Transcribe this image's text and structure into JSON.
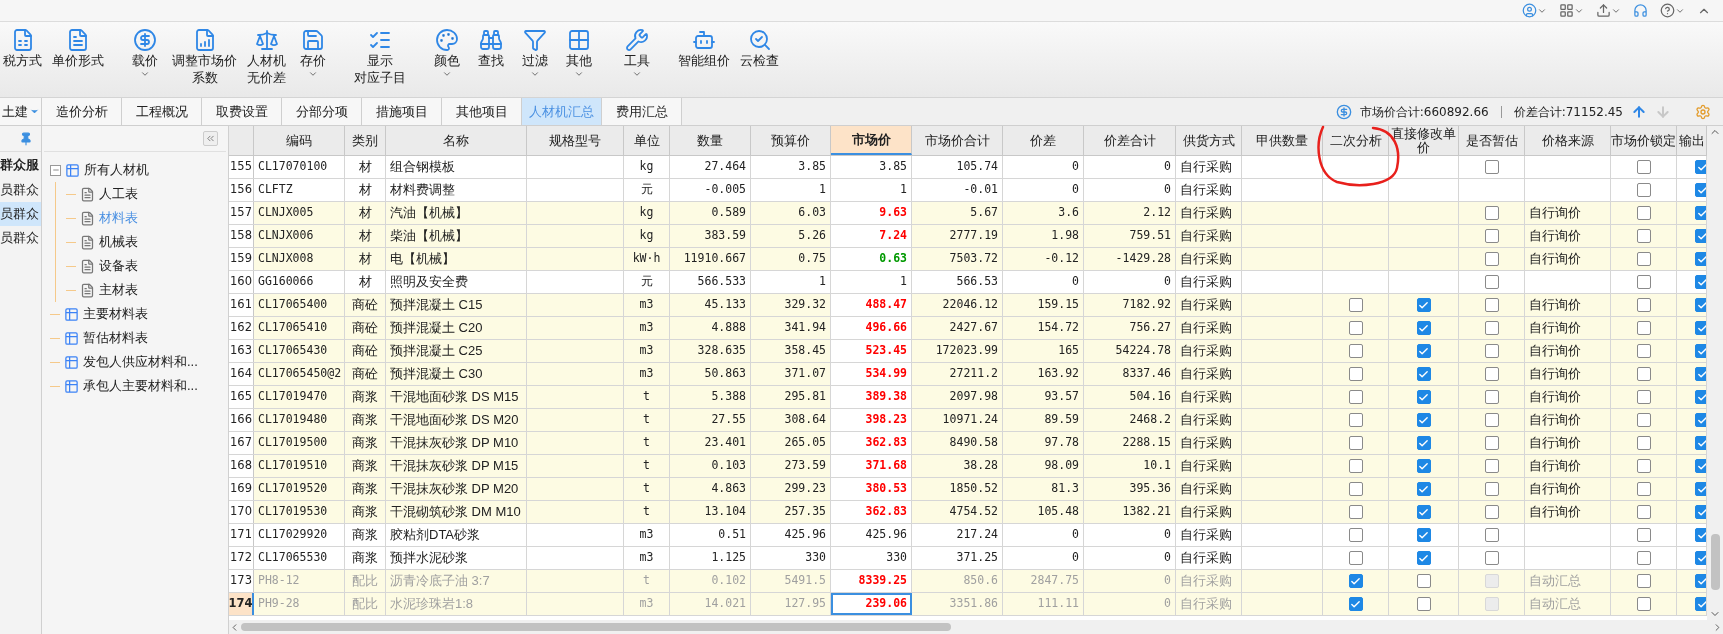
{
  "toolbar": {
    "groups": [
      {
        "items": [
          {
            "lines": [
              "税方式"
            ],
            "dropdown": false
          },
          {
            "lines": [
              "单价形式"
            ],
            "dropdown": false
          }
        ]
      },
      {
        "items": [
          {
            "lines": [
              "载价"
            ],
            "dropdown": true
          },
          {
            "lines": [
              "调整市场价",
              "系数"
            ],
            "dropdown": false
          },
          {
            "lines": [
              "人材机",
              "无价差"
            ],
            "dropdown": false
          },
          {
            "lines": [
              "存价"
            ],
            "dropdown": true
          }
        ]
      },
      {
        "items": [
          {
            "lines": [
              "显示",
              "对应子目"
            ],
            "dropdown": false
          }
        ]
      },
      {
        "items": [
          {
            "lines": [
              "颜色"
            ],
            "dropdown": true
          },
          {
            "lines": [
              "查找"
            ],
            "dropdown": false
          },
          {
            "lines": [
              "过滤"
            ],
            "dropdown": true
          },
          {
            "lines": [
              "其他"
            ],
            "dropdown": true
          }
        ]
      },
      {
        "items": [
          {
            "lines": [
              "工具"
            ],
            "dropdown": true
          }
        ]
      },
      {
        "items": [
          {
            "lines": [
              "智能组价"
            ],
            "dropdown": false
          },
          {
            "lines": [
              "云检查"
            ],
            "dropdown": false
          }
        ]
      }
    ]
  },
  "tabs": [
    {
      "label": "土建",
      "selected": false,
      "dropdown": true
    },
    {
      "label": "造价分析",
      "selected": false,
      "dropdown": false
    },
    {
      "label": "工程概况",
      "selected": false,
      "dropdown": false
    },
    {
      "label": "取费设置",
      "selected": false,
      "dropdown": false
    },
    {
      "label": "分部分项",
      "selected": false,
      "dropdown": false
    },
    {
      "label": "措施项目",
      "selected": false,
      "dropdown": false
    },
    {
      "label": "其他项目",
      "selected": false,
      "dropdown": false
    },
    {
      "label": "人材机汇总",
      "selected": true,
      "dropdown": false
    },
    {
      "label": "费用汇总",
      "selected": false,
      "dropdown": false
    }
  ],
  "summary": [
    "市场价合计:660892.66",
    "价差合计:71152.45"
  ],
  "side_list": {
    "heading": "群众服",
    "items": [
      {
        "label": "员群众",
        "selected": false
      },
      {
        "label": "员群众",
        "selected": true
      },
      {
        "label": "员群众",
        "selected": false
      }
    ]
  },
  "tree": [
    {
      "label": "所有人材机",
      "kind": "group",
      "expanded": true,
      "selected": false,
      "children": [
        {
          "label": "人工表",
          "kind": "sheet",
          "selected": false
        },
        {
          "label": "材料表",
          "kind": "sheet",
          "selected": true
        },
        {
          "label": "机械表",
          "kind": "sheet",
          "selected": false
        },
        {
          "label": "设备表",
          "kind": "sheet",
          "selected": false
        },
        {
          "label": "主材表",
          "kind": "sheet",
          "selected": false
        }
      ]
    },
    {
      "label": "主要材料表",
      "kind": "group",
      "selected": false
    },
    {
      "label": "暂估材料表",
      "kind": "group",
      "selected": false
    },
    {
      "label": "发包人供应材料和...",
      "kind": "group",
      "selected": false
    },
    {
      "label": "承包人主要材料和...",
      "kind": "group",
      "selected": false
    }
  ],
  "table": {
    "columns": [
      {
        "label": "编码",
        "selected": false
      },
      {
        "label": "类别",
        "selected": false
      },
      {
        "label": "名称",
        "selected": false
      },
      {
        "label": "规格型号",
        "selected": false
      },
      {
        "label": "单位",
        "selected": false
      },
      {
        "label": "数量",
        "selected": false
      },
      {
        "label": "预算价",
        "selected": false
      },
      {
        "label": "市场价",
        "selected": true
      },
      {
        "label": "市场价合计",
        "selected": false
      },
      {
        "label": "价差",
        "selected": false
      },
      {
        "label": "价差合计",
        "selected": false
      },
      {
        "label": "供货方式",
        "selected": false
      },
      {
        "label": "甲供数量",
        "selected": false
      },
      {
        "label": "二次分析",
        "selected": false
      },
      {
        "label": "直接修改单价",
        "selected": false
      },
      {
        "label": "是否暂估",
        "selected": false
      },
      {
        "label": "价格来源",
        "selected": false
      },
      {
        "label": "市场价锁定",
        "selected": false
      },
      {
        "label": "输出",
        "selected": false
      }
    ],
    "rows": [
      {
        "no": "155",
        "code": "CL17070100",
        "category": "材",
        "name": "组合钢模板",
        "unit": "kg",
        "quantity": "27.464",
        "budget_price": "3.85",
        "market_price": "3.85",
        "above_budget": false,
        "below_budget": false,
        "market_total": "105.74",
        "price_diff": "0",
        "diff_total": "0",
        "supply": "自行采购",
        "provisional": false,
        "provisional_disabled": false,
        "price_lock": false,
        "output": true,
        "shaded": false,
        "greyed": false,
        "selected": false
      },
      {
        "no": "156",
        "code": "CLFTZ",
        "category": "材",
        "name": "材料费调整",
        "unit": "元",
        "quantity": "-0.005",
        "budget_price": "1",
        "market_price": "1",
        "above_budget": false,
        "below_budget": false,
        "market_total": "-0.01",
        "price_diff": "0",
        "diff_total": "0",
        "supply": "自行采购",
        "price_lock": false,
        "output": true,
        "shaded": false,
        "greyed": false,
        "selected": false
      },
      {
        "no": "157",
        "code": "CLNJX005",
        "category": "材",
        "name": "汽油【机械】",
        "unit": "kg",
        "quantity": "0.589",
        "budget_price": "6.03",
        "market_price": "9.63",
        "above_budget": true,
        "below_budget": false,
        "market_total": "5.67",
        "price_diff": "3.6",
        "diff_total": "2.12",
        "supply": "自行采购",
        "provisional": false,
        "provisional_disabled": false,
        "price_source": "自行询价",
        "price_lock": false,
        "output": true,
        "shaded": true,
        "greyed": false,
        "selected": false
      },
      {
        "no": "158",
        "code": "CLNJX006",
        "category": "材",
        "name": "柴油【机械】",
        "unit": "kg",
        "quantity": "383.59",
        "budget_price": "5.26",
        "market_price": "7.24",
        "above_budget": true,
        "below_budget": false,
        "market_total": "2777.19",
        "price_diff": "1.98",
        "diff_total": "759.51",
        "supply": "自行采购",
        "provisional": false,
        "provisional_disabled": false,
        "price_source": "自行询价",
        "price_lock": false,
        "output": true,
        "shaded": true,
        "greyed": false,
        "selected": false
      },
      {
        "no": "159",
        "code": "CLNJX008",
        "category": "材",
        "name": "电【机械】",
        "unit": "kW·h",
        "quantity": "11910.667",
        "budget_price": "0.75",
        "market_price": "0.63",
        "above_budget": false,
        "below_budget": true,
        "market_total": "7503.72",
        "price_diff": "-0.12",
        "diff_total": "-1429.28",
        "supply": "自行采购",
        "provisional": false,
        "provisional_disabled": false,
        "price_source": "自行询价",
        "price_lock": false,
        "output": true,
        "shaded": true,
        "greyed": false,
        "selected": false
      },
      {
        "no": "160",
        "code": "GG160066",
        "category": "材",
        "name": "照明及安全费",
        "unit": "元",
        "quantity": "566.533",
        "budget_price": "1",
        "market_price": "1",
        "above_budget": false,
        "below_budget": false,
        "market_total": "566.53",
        "price_diff": "0",
        "diff_total": "0",
        "supply": "自行采购",
        "provisional": false,
        "provisional_disabled": false,
        "price_lock": false,
        "output": true,
        "shaded": false,
        "greyed": false,
        "selected": false
      },
      {
        "no": "161",
        "code": "CL17065400",
        "category": "商砼",
        "name": "预拌混凝土 C15",
        "unit": "m3",
        "quantity": "45.133",
        "budget_price": "329.32",
        "market_price": "488.47",
        "above_budget": true,
        "below_budget": false,
        "market_total": "22046.12",
        "price_diff": "159.15",
        "diff_total": "7182.92",
        "supply": "自行采购",
        "second_analysis": false,
        "direct_edit": true,
        "provisional": false,
        "provisional_disabled": false,
        "price_source": "自行询价",
        "price_lock": false,
        "output": true,
        "shaded": true,
        "greyed": false,
        "selected": false
      },
      {
        "no": "162",
        "code": "CL17065410",
        "category": "商砼",
        "name": "预拌混凝土 C20",
        "unit": "m3",
        "quantity": "4.888",
        "budget_price": "341.94",
        "market_price": "496.66",
        "above_budget": true,
        "below_budget": false,
        "market_total": "2427.67",
        "price_diff": "154.72",
        "diff_total": "756.27",
        "supply": "自行采购",
        "second_analysis": false,
        "direct_edit": true,
        "provisional": false,
        "provisional_disabled": false,
        "price_source": "自行询价",
        "price_lock": false,
        "output": true,
        "shaded": true,
        "greyed": false,
        "selected": false
      },
      {
        "no": "163",
        "code": "CL17065430",
        "category": "商砼",
        "name": "预拌混凝土 C25",
        "unit": "m3",
        "quantity": "328.635",
        "budget_price": "358.45",
        "market_price": "523.45",
        "above_budget": true,
        "below_budget": false,
        "market_total": "172023.99",
        "price_diff": "165",
        "diff_total": "54224.78",
        "supply": "自行采购",
        "second_analysis": false,
        "direct_edit": true,
        "provisional": false,
        "provisional_disabled": false,
        "price_source": "自行询价",
        "price_lock": false,
        "output": true,
        "shaded": true,
        "greyed": false,
        "selected": false
      },
      {
        "no": "164",
        "code": "CL17065450@2",
        "category": "商砼",
        "name": "预拌混凝土 C30",
        "unit": "m3",
        "quantity": "50.863",
        "budget_price": "371.07",
        "market_price": "534.99",
        "above_budget": true,
        "below_budget": false,
        "market_total": "27211.2",
        "price_diff": "163.92",
        "diff_total": "8337.46",
        "supply": "自行采购",
        "second_analysis": false,
        "direct_edit": true,
        "provisional": false,
        "provisional_disabled": false,
        "price_source": "自行询价",
        "price_lock": false,
        "output": true,
        "shaded": true,
        "greyed": false,
        "selected": false
      },
      {
        "no": "165",
        "code": "CL17019470",
        "category": "商浆",
        "name": "干混地面砂浆 DS M15",
        "unit": "t",
        "quantity": "5.388",
        "budget_price": "295.81",
        "market_price": "389.38",
        "above_budget": true,
        "below_budget": false,
        "market_total": "2097.98",
        "price_diff": "93.57",
        "diff_total": "504.16",
        "supply": "自行采购",
        "second_analysis": false,
        "direct_edit": true,
        "provisional": false,
        "provisional_disabled": false,
        "price_source": "自行询价",
        "price_lock": false,
        "output": true,
        "shaded": true,
        "greyed": false,
        "selected": false
      },
      {
        "no": "166",
        "code": "CL17019480",
        "category": "商浆",
        "name": "干混地面砂浆 DS M20",
        "unit": "t",
        "quantity": "27.55",
        "budget_price": "308.64",
        "market_price": "398.23",
        "above_budget": true,
        "below_budget": false,
        "market_total": "10971.24",
        "price_diff": "89.59",
        "diff_total": "2468.2",
        "supply": "自行采购",
        "second_analysis": false,
        "direct_edit": true,
        "provisional": false,
        "provisional_disabled": false,
        "price_source": "自行询价",
        "price_lock": false,
        "output": true,
        "shaded": true,
        "greyed": false,
        "selected": false
      },
      {
        "no": "167",
        "code": "CL17019500",
        "category": "商浆",
        "name": "干混抹灰砂浆 DP M10",
        "unit": "t",
        "quantity": "23.401",
        "budget_price": "265.05",
        "market_price": "362.83",
        "above_budget": true,
        "below_budget": false,
        "market_total": "8490.58",
        "price_diff": "97.78",
        "diff_total": "2288.15",
        "supply": "自行采购",
        "second_analysis": false,
        "direct_edit": true,
        "provisional": false,
        "provisional_disabled": false,
        "price_source": "自行询价",
        "price_lock": false,
        "output": true,
        "shaded": true,
        "greyed": false,
        "selected": false
      },
      {
        "no": "168",
        "code": "CL17019510",
        "category": "商浆",
        "name": "干混抹灰砂浆 DP M15",
        "unit": "t",
        "quantity": "0.103",
        "budget_price": "273.59",
        "market_price": "371.68",
        "above_budget": true,
        "below_budget": false,
        "market_total": "38.28",
        "price_diff": "98.09",
        "diff_total": "10.1",
        "supply": "自行采购",
        "second_analysis": false,
        "direct_edit": true,
        "provisional": false,
        "provisional_disabled": false,
        "price_source": "自行询价",
        "price_lock": false,
        "output": true,
        "shaded": true,
        "greyed": false,
        "selected": false
      },
      {
        "no": "169",
        "code": "CL17019520",
        "category": "商浆",
        "name": "干混抹灰砂浆 DP M20",
        "unit": "t",
        "quantity": "4.863",
        "budget_price": "299.23",
        "market_price": "380.53",
        "above_budget": true,
        "below_budget": false,
        "market_total": "1850.52",
        "price_diff": "81.3",
        "diff_total": "395.36",
        "supply": "自行采购",
        "second_analysis": false,
        "direct_edit": true,
        "provisional": false,
        "provisional_disabled": false,
        "price_source": "自行询价",
        "price_lock": false,
        "output": true,
        "shaded": true,
        "greyed": false,
        "selected": false
      },
      {
        "no": "170",
        "code": "CL17019530",
        "category": "商浆",
        "name": "干混砌筑砂浆 DM M10",
        "unit": "t",
        "quantity": "13.104",
        "budget_price": "257.35",
        "market_price": "362.83",
        "above_budget": true,
        "below_budget": false,
        "market_total": "4754.52",
        "price_diff": "105.48",
        "diff_total": "1382.21",
        "supply": "自行采购",
        "second_analysis": false,
        "direct_edit": true,
        "provisional": false,
        "provisional_disabled": false,
        "price_source": "自行询价",
        "price_lock": false,
        "output": true,
        "shaded": true,
        "greyed": false,
        "selected": false
      },
      {
        "no": "171",
        "code": "CL17029920",
        "category": "商浆",
        "name": "胶粘剂DTA砂浆",
        "unit": "m3",
        "quantity": "0.51",
        "budget_price": "425.96",
        "market_price": "425.96",
        "above_budget": false,
        "below_budget": false,
        "market_total": "217.24",
        "price_diff": "0",
        "diff_total": "0",
        "supply": "自行采购",
        "second_analysis": false,
        "direct_edit": true,
        "provisional": false,
        "provisional_disabled": false,
        "price_lock": false,
        "output": true,
        "shaded": false,
        "greyed": false,
        "selected": false
      },
      {
        "no": "172",
        "code": "CL17065530",
        "category": "商浆",
        "name": "预拌水泥砂浆",
        "unit": "m3",
        "quantity": "1.125",
        "budget_price": "330",
        "market_price": "330",
        "above_budget": false,
        "below_budget": false,
        "market_total": "371.25",
        "price_diff": "0",
        "diff_total": "0",
        "supply": "自行采购",
        "second_analysis": false,
        "direct_edit": true,
        "provisional": false,
        "provisional_disabled": false,
        "price_lock": false,
        "output": true,
        "shaded": false,
        "greyed": false,
        "selected": false
      },
      {
        "no": "173",
        "code": "PH8-12",
        "category": "配比",
        "name": "沥青冷底子油 3:7",
        "unit": "t",
        "quantity": "0.102",
        "budget_price": "5491.5",
        "market_price": "8339.25",
        "above_budget": true,
        "below_budget": false,
        "market_total": "850.6",
        "price_diff": "2847.75",
        "diff_total": "0",
        "supply": "自行采购",
        "second_analysis": true,
        "direct_edit": false,
        "provisional": false,
        "provisional_disabled": true,
        "price_source": "自动汇总",
        "price_lock": false,
        "output": true,
        "shaded": true,
        "greyed": true,
        "selected": false
      },
      {
        "no": "174",
        "code": "PH9-28",
        "category": "配比",
        "name": "水泥珍珠岩1:8",
        "unit": "m3",
        "quantity": "14.021",
        "budget_price": "127.95",
        "market_price": "239.06",
        "above_budget": true,
        "below_budget": false,
        "market_total": "3351.86",
        "price_diff": "111.11",
        "diff_total": "0",
        "supply": "自行采购",
        "second_analysis": true,
        "direct_edit": false,
        "provisional": false,
        "provisional_disabled": true,
        "price_source": "自动汇总",
        "price_lock": false,
        "output": true,
        "shaded": true,
        "greyed": true,
        "selected": true
      }
    ]
  },
  "annotations": [
    {
      "kind": "hand_circle"
    }
  ]
}
